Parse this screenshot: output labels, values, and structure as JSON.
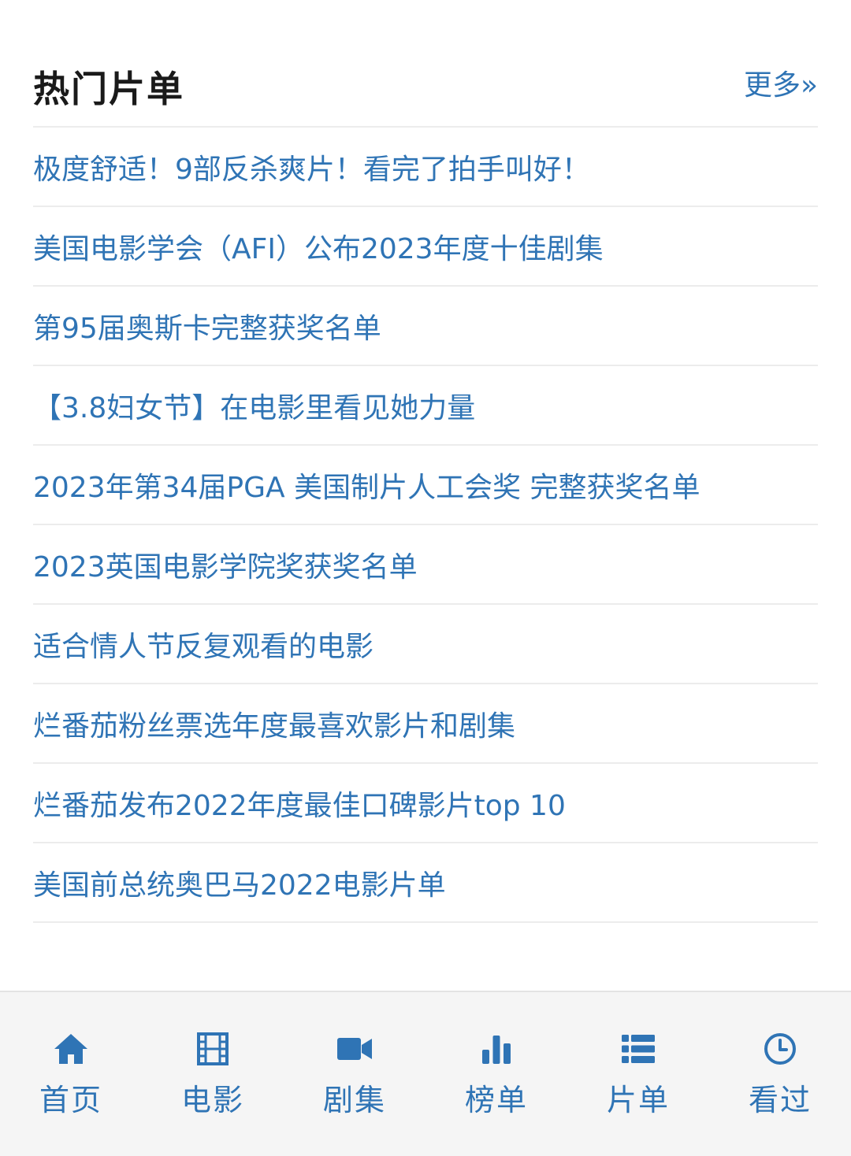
{
  "header": {
    "title": "热门片单",
    "more": "更多»"
  },
  "list": [
    "极度舒适！9部反杀爽片！看完了拍手叫好！",
    "美国电影学会（AFI）公布2023年度十佳剧集",
    "第95届奥斯卡完整获奖名单",
    "【3.8妇女节】在电影里看见她力量",
    "2023年第34届PGA 美国制片人工会奖 完整获奖名单",
    "2023英国电影学院奖获奖名单",
    "适合情人节反复观看的电影",
    "烂番茄粉丝票选年度最喜欢影片和剧集",
    "烂番茄发布2022年度最佳口碑影片top 10",
    "美国前总统奥巴马2022电影片单"
  ],
  "tabs": [
    {
      "label": "首页",
      "icon": "home-icon"
    },
    {
      "label": "电影",
      "icon": "film-icon"
    },
    {
      "label": "剧集",
      "icon": "video-camera-icon"
    },
    {
      "label": "榜单",
      "icon": "bar-chart-icon"
    },
    {
      "label": "片单",
      "icon": "list-icon"
    },
    {
      "label": "看过",
      "icon": "clock-icon"
    }
  ],
  "colors": {
    "accent": "#2f74b5",
    "title": "#1a1a1a",
    "divider": "#ececec",
    "tabbar_bg": "#f5f5f5"
  }
}
